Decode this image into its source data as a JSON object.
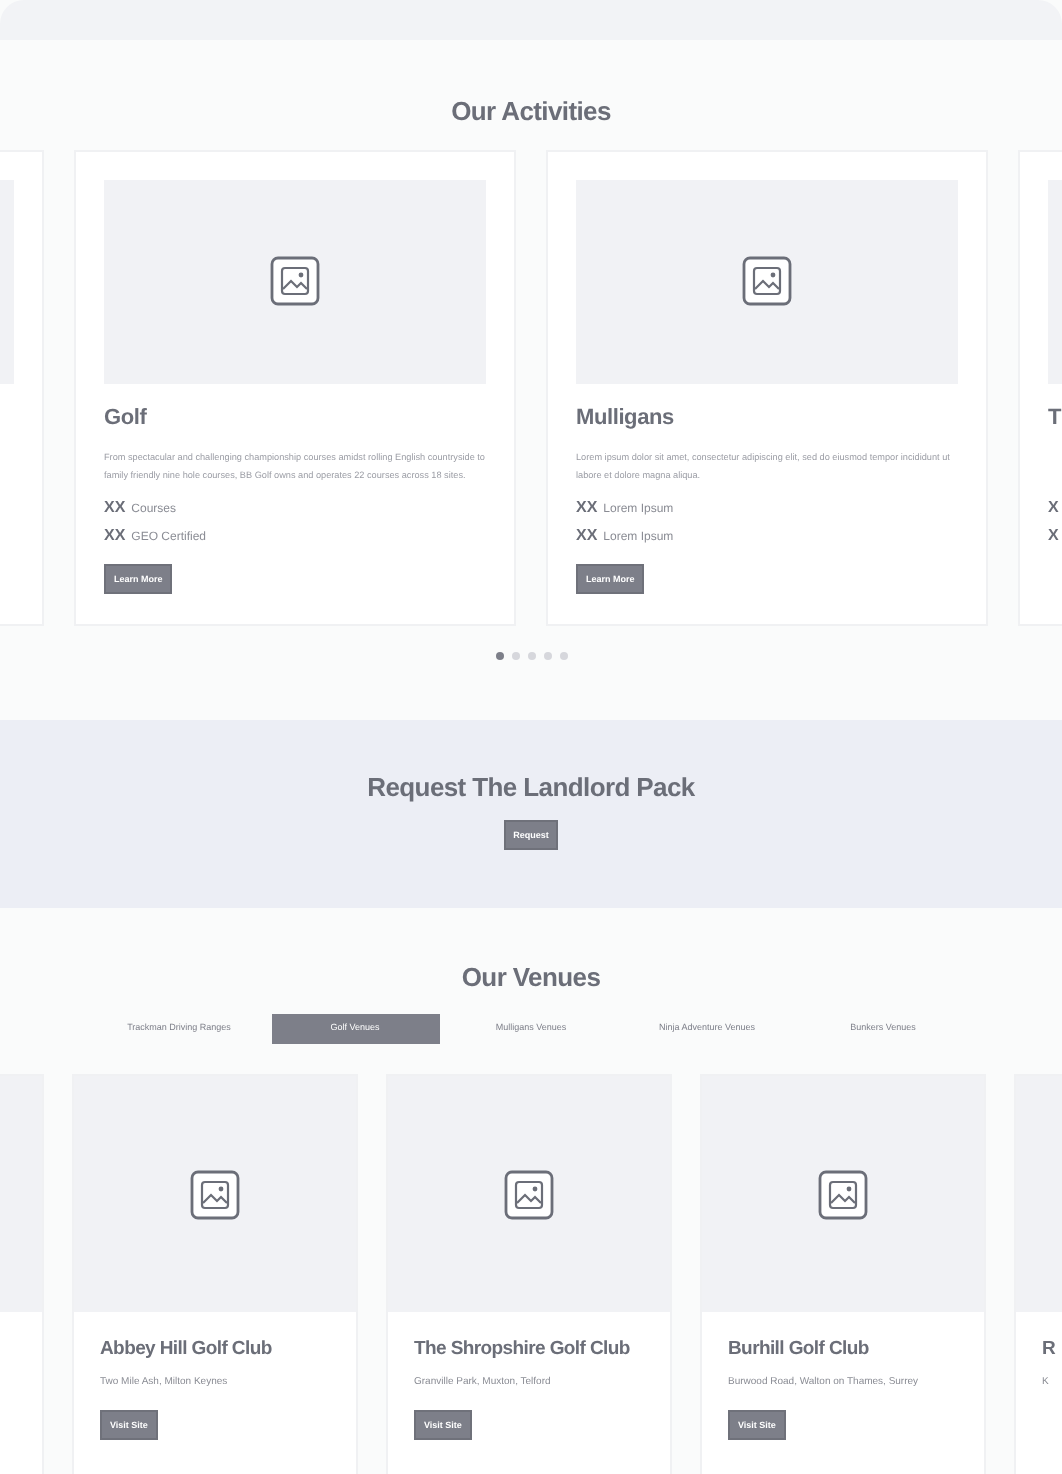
{
  "activities": {
    "title": "Our Activities",
    "cards": [
      {
        "kind": "blank"
      },
      {
        "kind": "full",
        "title": "Golf",
        "description": "From spectacular and challenging championship courses amidst rolling English countryside to family friendly nine hole courses, BB Golf owns and operates 22 courses across 18 sites.",
        "stats": [
          {
            "value": "XX",
            "label": "Courses"
          },
          {
            "value": "XX",
            "label": "GEO Certified"
          }
        ],
        "button": "Learn More"
      },
      {
        "kind": "full",
        "title": "Mulligans",
        "description": "Lorem ipsum dolor sit amet, consectetur adipiscing elit, sed do eiusmod tempor incididunt ut labore et dolore magna aliqua.",
        "stats": [
          {
            "value": "XX",
            "label": "Lorem Ipsum"
          },
          {
            "value": "XX",
            "label": "Lorem Ipsum"
          }
        ],
        "button": "Learn More"
      },
      {
        "kind": "partial",
        "title": "T",
        "stats": [
          {
            "value": "X"
          },
          {
            "value": "X"
          }
        ]
      }
    ],
    "dots": [
      {
        "selected": true
      },
      {
        "selected": false
      },
      {
        "selected": false
      },
      {
        "selected": false
      },
      {
        "selected": false
      }
    ]
  },
  "landlord_pack": {
    "title": "Request The Landlord Pack",
    "button": "Request"
  },
  "venues": {
    "title": "Our Venues",
    "tabs": [
      {
        "label": "Trackman Driving Ranges",
        "selected": false
      },
      {
        "label": "Golf Venues",
        "selected": true
      },
      {
        "label": "Mulligans Venues",
        "selected": false
      },
      {
        "label": "Ninja Adventure Venues",
        "selected": false
      },
      {
        "label": "Bunkers Venues",
        "selected": false
      }
    ],
    "cards": [
      {
        "kind": "blank"
      },
      {
        "kind": "full",
        "title": "Abbey Hill Golf Club",
        "address": "Two Mile Ash, Milton Keynes",
        "button": "Visit Site"
      },
      {
        "kind": "full",
        "title": "The Shropshire Golf Club",
        "address": "Granville Park, Muxton, Telford",
        "button": "Visit Site"
      },
      {
        "kind": "full",
        "title": "Burhill Golf Club",
        "address": "Burwood Road, Walton on Thames, Surrey",
        "button": "Visit Site"
      },
      {
        "kind": "partial",
        "title": "R",
        "address": "K"
      }
    ]
  }
}
